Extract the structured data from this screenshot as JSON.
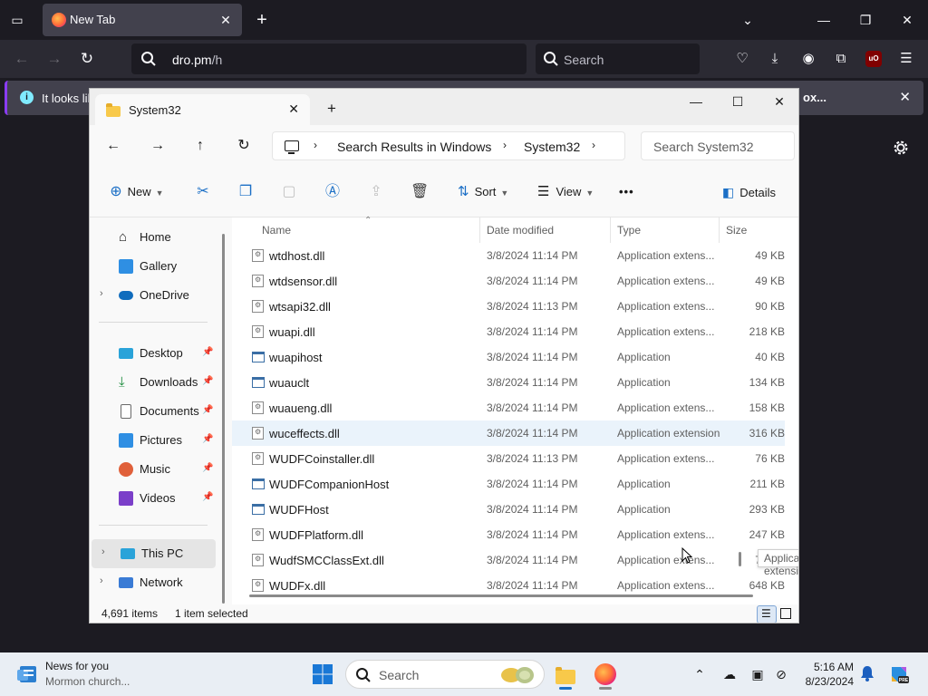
{
  "browser": {
    "tab_title": "New Tab",
    "url_host": "dro.pm",
    "url_path": "/h",
    "search_placeholder": "Search",
    "notification_text": "It looks lik",
    "notification_button": "ox..."
  },
  "explorer": {
    "tab_title": "System32",
    "breadcrumbs": [
      "Search Results in Windows",
      "System32"
    ],
    "search_placeholder": "Search System32",
    "toolbar": {
      "new_label": "New",
      "sort_label": "Sort",
      "view_label": "View",
      "more_label": "•••",
      "details_label": "Details"
    },
    "nav": {
      "home": "Home",
      "gallery": "Gallery",
      "onedrive": "OneDrive",
      "desktop": "Desktop",
      "downloads": "Downloads",
      "documents": "Documents",
      "pictures": "Pictures",
      "music": "Music",
      "videos": "Videos",
      "this_pc": "This PC",
      "network": "Network"
    },
    "columns": {
      "name": "Name",
      "date": "Date modified",
      "type": "Type",
      "size": "Size"
    },
    "files": [
      {
        "name": "wtdhost.dll",
        "date": "3/8/2024 11:14 PM",
        "type": "Application extens...",
        "size": "49 KB",
        "kind": "dll"
      },
      {
        "name": "wtdsensor.dll",
        "date": "3/8/2024 11:14 PM",
        "type": "Application extens...",
        "size": "49 KB",
        "kind": "dll"
      },
      {
        "name": "wtsapi32.dll",
        "date": "3/8/2024 11:13 PM",
        "type": "Application extens...",
        "size": "90 KB",
        "kind": "dll"
      },
      {
        "name": "wuapi.dll",
        "date": "3/8/2024 11:14 PM",
        "type": "Application extens...",
        "size": "218 KB",
        "kind": "dll"
      },
      {
        "name": "wuapihost",
        "date": "3/8/2024 11:14 PM",
        "type": "Application",
        "size": "40 KB",
        "kind": "app"
      },
      {
        "name": "wuauclt",
        "date": "3/8/2024 11:14 PM",
        "type": "Application",
        "size": "134 KB",
        "kind": "app"
      },
      {
        "name": "wuaueng.dll",
        "date": "3/8/2024 11:14 PM",
        "type": "Application extens...",
        "size": "158 KB",
        "kind": "dll"
      },
      {
        "name": "wuceffects.dll",
        "date": "3/8/2024 11:14 PM",
        "type": "Application extension",
        "size": "316 KB",
        "kind": "dll"
      },
      {
        "name": "WUDFCoinstaller.dll",
        "date": "3/8/2024 11:13 PM",
        "type": "Application extens...",
        "size": "76 KB",
        "kind": "dll"
      },
      {
        "name": "WUDFCompanionHost",
        "date": "3/8/2024 11:14 PM",
        "type": "Application",
        "size": "211 KB",
        "kind": "app"
      },
      {
        "name": "WUDFHost",
        "date": "3/8/2024 11:14 PM",
        "type": "Application",
        "size": "293 KB",
        "kind": "app"
      },
      {
        "name": "WUDFPlatform.dll",
        "date": "3/8/2024 11:14 PM",
        "type": "Application extens...",
        "size": "247 KB",
        "kind": "dll"
      },
      {
        "name": "WudfSMCClassExt.dll",
        "date": "3/8/2024 11:14 PM",
        "type": "Application extens...",
        "size": "76 KB",
        "kind": "dll"
      },
      {
        "name": "WUDFx.dll",
        "date": "3/8/2024 11:14 PM",
        "type": "Application extens...",
        "size": "648 KB",
        "kind": "dll"
      }
    ],
    "hover_row_index": 7,
    "tooltip": "Application extension",
    "status": {
      "item_count": "4,691 items",
      "selected": "1 item selected"
    }
  },
  "taskbar": {
    "news_title": "News for you",
    "news_subtitle": "Mormon church...",
    "search_placeholder": "Search",
    "time": "5:16 AM",
    "date": "8/23/2024"
  },
  "colors": {
    "firefox_dark": "#1c1b22",
    "firefox_toolbar": "#2b2a33",
    "accent_blue": "#1b6fc6",
    "notification_border": "#8a3cf3"
  }
}
